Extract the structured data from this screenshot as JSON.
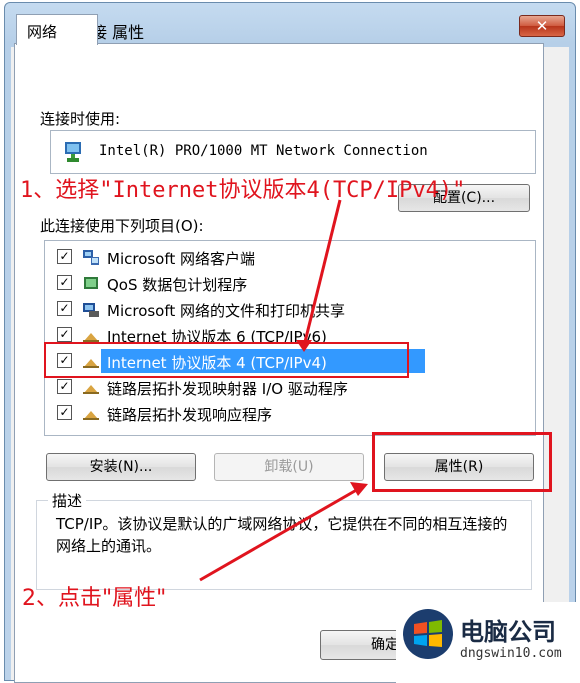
{
  "window": {
    "title": "本地连接 属性",
    "close_glyph": "✕"
  },
  "tab": {
    "label": "网络"
  },
  "connect_using": {
    "label": "连接时使用:",
    "adapter": "Intel(R) PRO/1000 MT Network Connection",
    "configure_button": "配置(C)..."
  },
  "items_section": {
    "label": "此连接使用下列项目(O):"
  },
  "items": [
    {
      "label": "Microsoft 网络客户端",
      "checked": true,
      "icon": "network-client-icon"
    },
    {
      "label": "QoS 数据包计划程序",
      "checked": true,
      "icon": "qos-icon"
    },
    {
      "label": "Microsoft 网络的文件和打印机共享",
      "checked": true,
      "icon": "file-printer-share-icon"
    },
    {
      "label": "Internet 协议版本 6 (TCP/IPv6)",
      "checked": true,
      "icon": "protocol-icon"
    },
    {
      "label": "Internet 协议版本 4 (TCP/IPv4)",
      "checked": true,
      "icon": "protocol-icon",
      "selected": true
    },
    {
      "label": "链路层拓扑发现映射器 I/O 驱动程序",
      "checked": true,
      "icon": "protocol-icon"
    },
    {
      "label": "链路层拓扑发现响应程序",
      "checked": true,
      "icon": "protocol-icon"
    }
  ],
  "check_glyph": "✓",
  "buttons": {
    "install": "安装(N)...",
    "uninstall": "卸载(U)",
    "properties": "属性(R)",
    "ok": "确定"
  },
  "description": {
    "title": "描述",
    "text": "TCP/IP。该协议是默认的广域网络协议，它提供在不同的相互连接的网络上的通讯。"
  },
  "annotations": {
    "step1": "1、选择\"Internet协议版本4(TCP/IPv4)\"",
    "step2": "2、点击\"属性\"",
    "color": "#e0141e"
  },
  "watermark": {
    "name": "电脑公司",
    "url": "dngswin10.com"
  }
}
